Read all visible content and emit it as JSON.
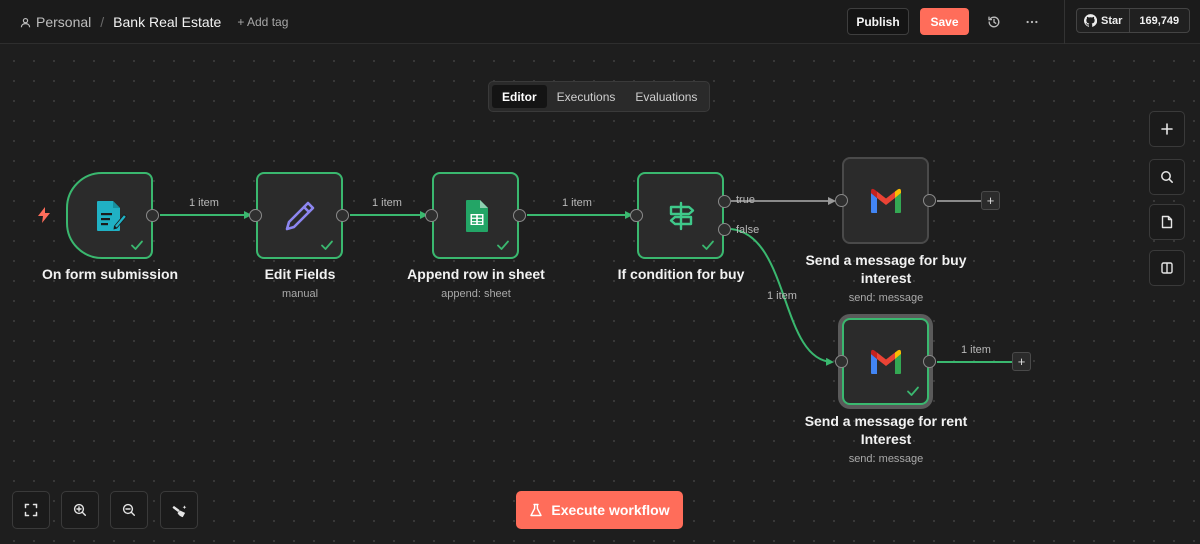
{
  "header": {
    "workspace": "Personal",
    "separator": "/",
    "workflow_name": "Bank Real Estate",
    "add_tag_label": "+ Add tag",
    "publish_label": "Publish",
    "save_label": "Save",
    "github": {
      "star_label": "Star",
      "star_count": "169,749"
    }
  },
  "tabs": [
    {
      "label": "Editor",
      "active": true
    },
    {
      "label": "Executions",
      "active": false
    },
    {
      "label": "Evaluations",
      "active": false
    }
  ],
  "nodes": {
    "form": {
      "title": "On form submission",
      "subtitle": ""
    },
    "edit": {
      "title": "Edit Fields",
      "subtitle": "manual"
    },
    "append": {
      "title": "Append row in sheet",
      "subtitle": "append: sheet"
    },
    "if": {
      "title": "If condition for buy",
      "subtitle": ""
    },
    "buy": {
      "title_line1": "Send a message for buy",
      "title_line2": "interest",
      "subtitle": "send: message"
    },
    "rent": {
      "title_line1": "Send a message for rent",
      "title_line2": "Interest",
      "subtitle": "send: message"
    }
  },
  "edges": {
    "form_edit": "1 item",
    "edit_append": "1 item",
    "append_if": "1 item",
    "if_true": "true",
    "if_false": "false",
    "false_rent": "1 item",
    "rent_out": "1 item"
  },
  "execute_label": "Execute workflow",
  "colors": {
    "accent": "#ff6d5a",
    "success": "#3ab86f",
    "canvas": "#1e1e1e"
  }
}
